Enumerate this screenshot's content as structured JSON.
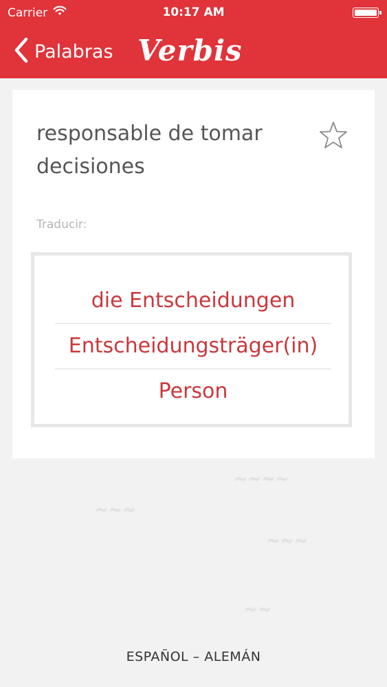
{
  "status_bar": {
    "carrier": "Carrier",
    "time": "10:17 AM"
  },
  "nav": {
    "back_label": "Palabras",
    "app_title": "Verbis"
  },
  "entry": {
    "word": "responsable de tomar decisiones",
    "translate_label": "Traducir:",
    "translations": [
      "die Entscheidungen",
      "Entscheidungsträger(in)",
      "Person"
    ]
  },
  "footer": {
    "language_pair": "ESPAÑOL – ALEMÁN"
  },
  "colors": {
    "accent": "#e0333a",
    "translation_text": "#c9383c",
    "background": "#f2f2f2"
  }
}
